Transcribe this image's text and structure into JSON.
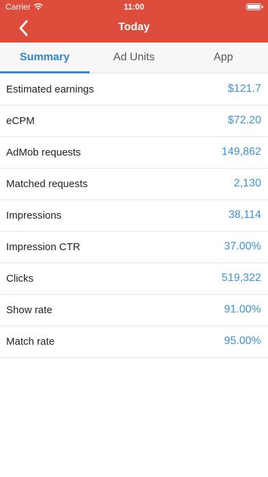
{
  "status_bar": {
    "carrier": "Carrier",
    "time": "11:00"
  },
  "nav": {
    "title": "Today",
    "back_icon": "chevron-left-icon"
  },
  "tabs": [
    {
      "label": "Summary",
      "active": true
    },
    {
      "label": "Ad Units",
      "active": false
    },
    {
      "label": "App",
      "active": false
    }
  ],
  "metrics": [
    {
      "label": "Estimated earnings",
      "value": "$121.7"
    },
    {
      "label": "eCPM",
      "value": "$72.20"
    },
    {
      "label": "AdMob requests",
      "value": "149,862"
    },
    {
      "label": "Matched requests",
      "value": "2,130"
    },
    {
      "label": "Impressions",
      "value": "38,114"
    },
    {
      "label": "Impression CTR",
      "value": "37.00%"
    },
    {
      "label": "Clicks",
      "value": "519,322"
    },
    {
      "label": "Show rate",
      "value": "91.00%"
    },
    {
      "label": "Match rate",
      "value": "95.00%"
    }
  ],
  "colors": {
    "brand": "#de4c3c",
    "accent": "#2f86d8",
    "value_text": "#3a93e0"
  }
}
